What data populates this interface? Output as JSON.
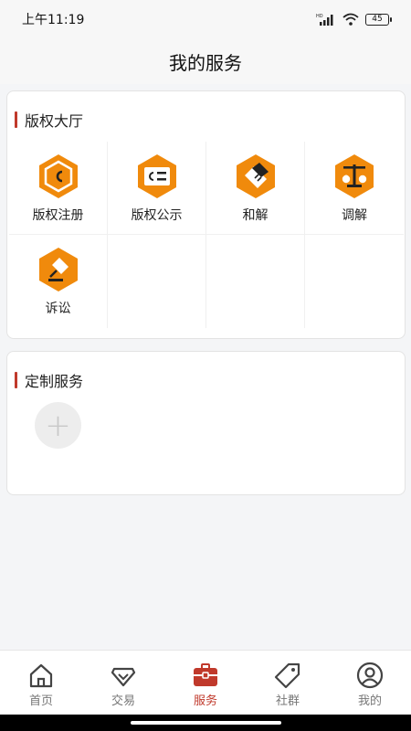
{
  "status_bar": {
    "time": "上午11:19",
    "battery": "45"
  },
  "header": {
    "title": "我的服务"
  },
  "hall": {
    "title": "版权大厅",
    "items": [
      {
        "label": "版权注册",
        "icon": "copyright-register-icon"
      },
      {
        "label": "版权公示",
        "icon": "copyright-publicity-icon"
      },
      {
        "label": "和解",
        "icon": "handshake-icon"
      },
      {
        "label": "调解",
        "icon": "scales-icon"
      },
      {
        "label": "诉讼",
        "icon": "gavel-icon"
      }
    ]
  },
  "custom": {
    "title": "定制服务",
    "add_label": "+"
  },
  "tabs": [
    {
      "label": "首页",
      "icon": "home-icon"
    },
    {
      "label": "交易",
      "icon": "diamond-icon"
    },
    {
      "label": "服务",
      "icon": "toolbox-icon"
    },
    {
      "label": "社群",
      "icon": "tag-icon"
    },
    {
      "label": "我的",
      "icon": "user-icon"
    }
  ],
  "colors": {
    "accent": "#c0392b",
    "icon_orange": "#f08a0c",
    "background": "#f4f5f7"
  }
}
